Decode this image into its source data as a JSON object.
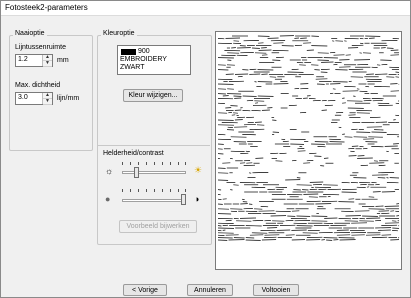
{
  "window": {
    "title": "Fotosteek2-parameters"
  },
  "naaioptie": {
    "title": "Naaioptie",
    "line_spacing_label": "Lijntussenruimte",
    "line_spacing_value": "1.2",
    "line_spacing_unit": "mm",
    "max_density_label": "Max. dichtheid",
    "max_density_value": "3.0",
    "max_density_unit": "lijn/mm"
  },
  "kleuroptie": {
    "title": "Kleuroptie",
    "color_code": "900",
    "color_brand": "EMBROIDERY",
    "color_name": "ZWART",
    "swatch_color": "#000000",
    "change_color_button": "Kleur wijzigen..."
  },
  "brightness_contrast": {
    "title": "Helderheid/contrast",
    "brightness_icon_low": "sun-small-icon",
    "brightness_icon_high": "sun-large-icon",
    "contrast_icon_low": "circle-filled-icon",
    "contrast_icon_high": "circle-half-icon",
    "brightness_level": 0.2,
    "contrast_level": 1.0
  },
  "update_preview_button": "Voorbeeld bijwerken",
  "footer": {
    "back": "< Vorige",
    "cancel": "Annuleren",
    "finish": "Voltooien"
  }
}
